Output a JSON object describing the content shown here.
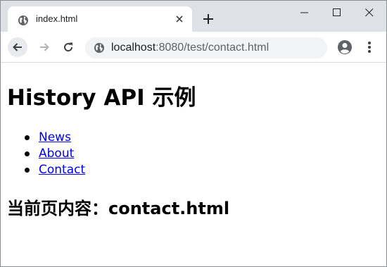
{
  "browser": {
    "tab": {
      "title": "index.html",
      "favicon": "globe-icon"
    },
    "new_tab_icon": "plus-icon",
    "window_controls": [
      "minimize-icon",
      "maximize-icon",
      "close-icon"
    ],
    "toolbar": {
      "back_icon": "arrow-left-icon",
      "forward_icon": "arrow-right-icon",
      "reload_icon": "reload-icon",
      "address": {
        "host": "localhost",
        "rest": ":8080/test/contact.html"
      },
      "site_info_icon": "globe-icon",
      "profile_icon": "account-circle-icon",
      "menu_icon": "more-vertical-icon"
    }
  },
  "page": {
    "heading": "History API 示例",
    "links": [
      "News",
      "About",
      "Contact"
    ],
    "content": "当前页内容：contact.html"
  },
  "colors": {
    "tabstrip": "#dee1e6",
    "omnibox": "#f1f3f4",
    "link": "#0000ee"
  }
}
